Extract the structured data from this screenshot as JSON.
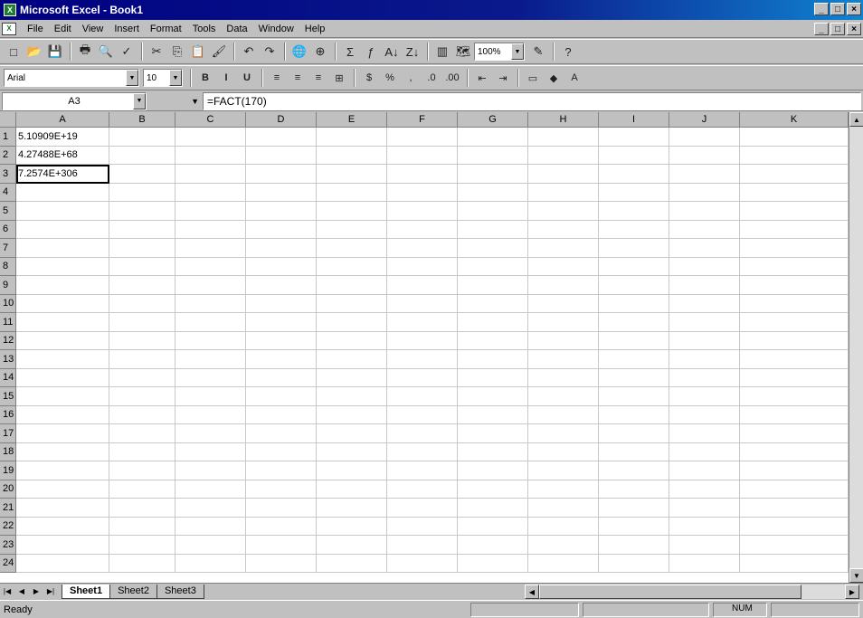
{
  "window": {
    "title": "Microsoft Excel - Book1",
    "app_icon": "X",
    "controls": [
      "_",
      "□",
      "×"
    ]
  },
  "menubar": {
    "items": [
      "File",
      "Edit",
      "View",
      "Insert",
      "Format",
      "Tools",
      "Data",
      "Window",
      "Help"
    ],
    "doc_controls": [
      "_",
      "□",
      "×"
    ]
  },
  "standard_toolbar": {
    "buttons": [
      "new-icon",
      "open-icon",
      "save-icon",
      "print-icon",
      "print-preview-icon",
      "spelling-icon",
      "cut-icon",
      "copy-icon",
      "paste-icon",
      "format-painter-icon",
      "undo-icon",
      "redo-icon",
      "hyperlink-icon",
      "web-toolbar-icon",
      "autosum-icon",
      "function-icon",
      "sort-ascending-icon",
      "sort-descending-icon",
      "chart-wizard-icon",
      "map-icon",
      "drawing-icon",
      "help-icon"
    ],
    "glyphs": [
      "□",
      "📂",
      "💾",
      "🖶",
      "🔍",
      "✓",
      "✂",
      "⎘",
      "📋",
      "🖌",
      "↶",
      "↷",
      "🌐",
      "⊕",
      "Σ",
      "ƒ",
      "A↓",
      "Z↓",
      "▥",
      "🗺",
      "✎",
      "?"
    ],
    "zoom": "100%"
  },
  "formatting_toolbar": {
    "font": "Arial",
    "font_size": "10",
    "buttons": [
      "B",
      "I",
      "U",
      "≡",
      "≡",
      "≡",
      "⊞",
      "$",
      "%",
      ",",
      ".0",
      ".00",
      "⇤",
      "⇥",
      "▭",
      "◆",
      "A"
    ],
    "button_names": [
      "bold-button",
      "italic-button",
      "underline-button",
      "align-left-button",
      "center-button",
      "align-right-button",
      "merge-center-button",
      "currency-button",
      "percent-button",
      "comma-button",
      "increase-decimal-button",
      "decrease-decimal-button",
      "decrease-indent-button",
      "increase-indent-button",
      "borders-button",
      "fill-color-button",
      "font-color-button"
    ]
  },
  "formula_bar": {
    "name_box": "A3",
    "formula": "=FACT(170)"
  },
  "columns": [
    "A",
    "B",
    "C",
    "D",
    "E",
    "F",
    "G",
    "H",
    "I",
    "J",
    "K"
  ],
  "rows": [
    "1",
    "2",
    "3",
    "4",
    "5",
    "6",
    "7",
    "8",
    "9",
    "10",
    "11",
    "12",
    "13",
    "14",
    "15",
    "16",
    "17",
    "18",
    "19",
    "20",
    "21",
    "22",
    "23",
    "24"
  ],
  "cells": {
    "A1": "5.10909E+19",
    "A2": "4.27488E+68",
    "A3": "7.2574E+306"
  },
  "sheet_tabs": [
    "Sheet1",
    "Sheet2",
    "Sheet3"
  ],
  "active_sheet": "Sheet1",
  "status": {
    "text": "Ready",
    "mode": "NUM"
  }
}
